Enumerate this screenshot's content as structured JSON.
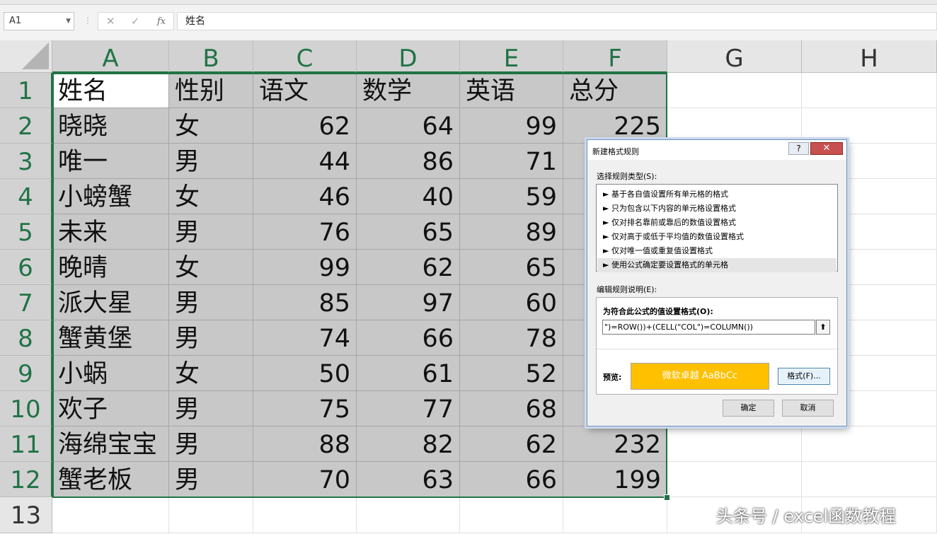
{
  "formula_bar": {
    "name_box": "A1",
    "cancel_icon": "✕",
    "enter_icon": "✓",
    "fx_label": "fx",
    "formula_value": "姓名"
  },
  "columns": [
    {
      "label": "A",
      "selected": true
    },
    {
      "label": "B",
      "selected": true
    },
    {
      "label": "C",
      "selected": true
    },
    {
      "label": "D",
      "selected": true
    },
    {
      "label": "E",
      "selected": true
    },
    {
      "label": "F",
      "selected": true
    },
    {
      "label": "G",
      "selected": false
    },
    {
      "label": "H",
      "selected": false
    }
  ],
  "rows": [
    "1",
    "2",
    "3",
    "4",
    "5",
    "6",
    "7",
    "8",
    "9",
    "10",
    "11",
    "12",
    "13"
  ],
  "table": {
    "header": [
      "姓名",
      "性别",
      "语文",
      "数学",
      "英语",
      "总分"
    ],
    "data": [
      [
        "晓晓",
        "女",
        "62",
        "64",
        "99",
        "225"
      ],
      [
        "唯一",
        "男",
        "44",
        "86",
        "71",
        ""
      ],
      [
        "小螃蟹",
        "女",
        "46",
        "40",
        "59",
        ""
      ],
      [
        "未来",
        "男",
        "76",
        "65",
        "89",
        ""
      ],
      [
        "晚晴",
        "女",
        "99",
        "62",
        "65",
        ""
      ],
      [
        "派大星",
        "男",
        "85",
        "97",
        "60",
        ""
      ],
      [
        "蟹黄堡",
        "男",
        "74",
        "66",
        "78",
        ""
      ],
      [
        "小蜗",
        "女",
        "50",
        "61",
        "52",
        ""
      ],
      [
        "欢子",
        "男",
        "75",
        "77",
        "68",
        ""
      ],
      [
        "海绵宝宝",
        "男",
        "88",
        "82",
        "62",
        "232"
      ],
      [
        "蟹老板",
        "男",
        "70",
        "63",
        "66",
        "199"
      ]
    ]
  },
  "dialog": {
    "title": "新建格式规则",
    "help_label": "?",
    "close_label": "✕",
    "rule_type_label": "选择规则类型(S):",
    "rule_types": [
      "► 基于各自值设置所有单元格的格式",
      "► 只为包含以下内容的单元格设置格式",
      "► 仅对排名靠前或靠后的数值设置格式",
      "► 仅对高于或低于平均值的数值设置格式",
      "► 仅对唯一值或重复值设置格式",
      "► 使用公式确定要设置格式的单元格"
    ],
    "selected_rule_index": 5,
    "edit_label": "编辑规则说明(E):",
    "formula_label": "为符合此公式的值设置格式(O):",
    "formula_value": "\")=ROW())+(CELL(\"COL\")=COLUMN())",
    "collapse_icon": "⬆",
    "preview_label": "预览:",
    "preview_text": "微软卓越  AaBbCc",
    "preview_color": "#ffc000",
    "format_button": "格式(F)...",
    "ok_button": "确定",
    "cancel_button": "取消"
  },
  "watermark": "头条号 / excel函数教程"
}
